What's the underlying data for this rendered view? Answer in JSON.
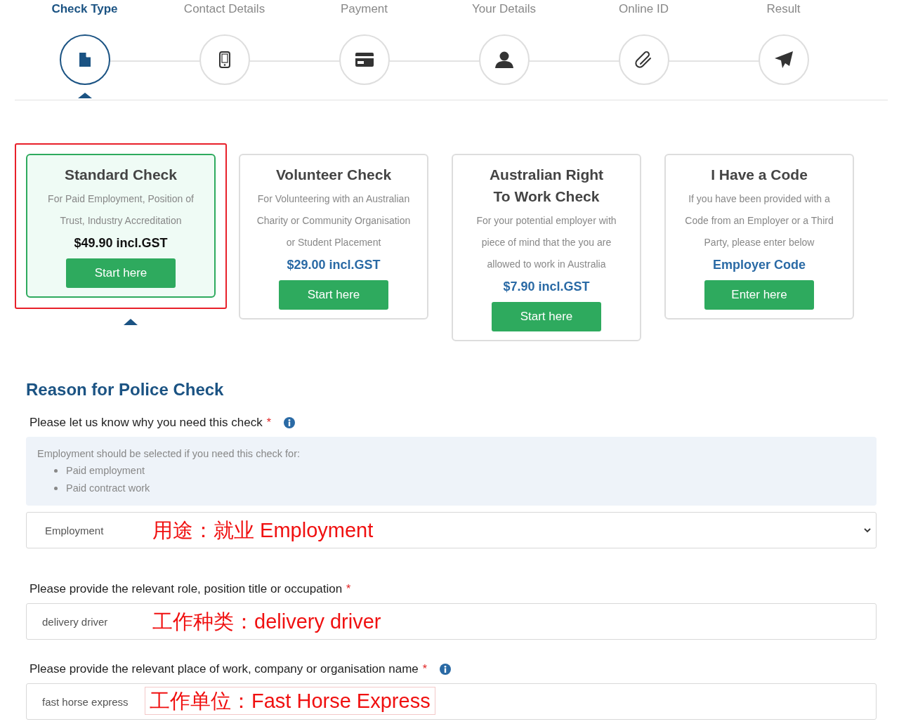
{
  "steps": [
    {
      "label": "Check Type",
      "selected": true
    },
    {
      "label": "Contact Details",
      "selected": false
    },
    {
      "label": "Payment",
      "selected": false
    },
    {
      "label": "Your Details",
      "selected": false
    },
    {
      "label": "Online ID",
      "selected": false
    },
    {
      "label": "Result",
      "selected": false
    }
  ],
  "check_types": [
    {
      "kind": "priced",
      "title": "Standard Check",
      "description": "For Paid Employment, Position of Trust, Industry Accreditation",
      "price": "$49.90 incl.GST",
      "button": "Start here",
      "selected": true,
      "annotation_frame": true
    },
    {
      "kind": "priced",
      "title": "Volunteer Check",
      "description": "For Volunteering with an Australian Charity or Community Organisation or Student Placement",
      "price": "$29.00 incl.GST",
      "button": "Start here",
      "selected": false,
      "annotation_frame": false
    },
    {
      "kind": "priced",
      "title": "Australian Right To Work Check",
      "description": "For your potential employer with piece of mind that the you are allowed to work in Australia",
      "price": "$7.90 incl.GST",
      "button": "Start here",
      "selected": false,
      "annotation_frame": false
    },
    {
      "kind": "code",
      "title": "I Have a Code",
      "description": "If you have been provided with a Code from an Employer or a Third Party, please enter below",
      "code_label": "Employer Code",
      "button": "Enter here",
      "selected": false,
      "annotation_frame": false
    }
  ],
  "reason_section": {
    "heading": "Reason for Police Check",
    "fields": [
      {
        "kind": "select",
        "label": "Please let us know why you need this check",
        "required_mark": "*",
        "info": true,
        "help": {
          "intro": "Employment should be selected if you need this check for:",
          "items": [
            "Paid employment",
            "Paid contract work"
          ]
        },
        "value": "Employment",
        "annotation": {
          "text": "用途：就业 Employment",
          "boxed": false
        }
      },
      {
        "kind": "text",
        "label": "Please provide the relevant role, position title or occupation",
        "required_mark": "*",
        "value": "delivery driver",
        "annotation": {
          "text": "工作种类：delivery driver",
          "boxed": false
        }
      },
      {
        "kind": "text",
        "label": "Please provide the relevant place of work, company or organisation name",
        "required_mark": "*",
        "info": true,
        "value": "fast horse express",
        "annotation": {
          "text": "工作单位：Fast Horse Express",
          "boxed": true
        }
      }
    ]
  }
}
